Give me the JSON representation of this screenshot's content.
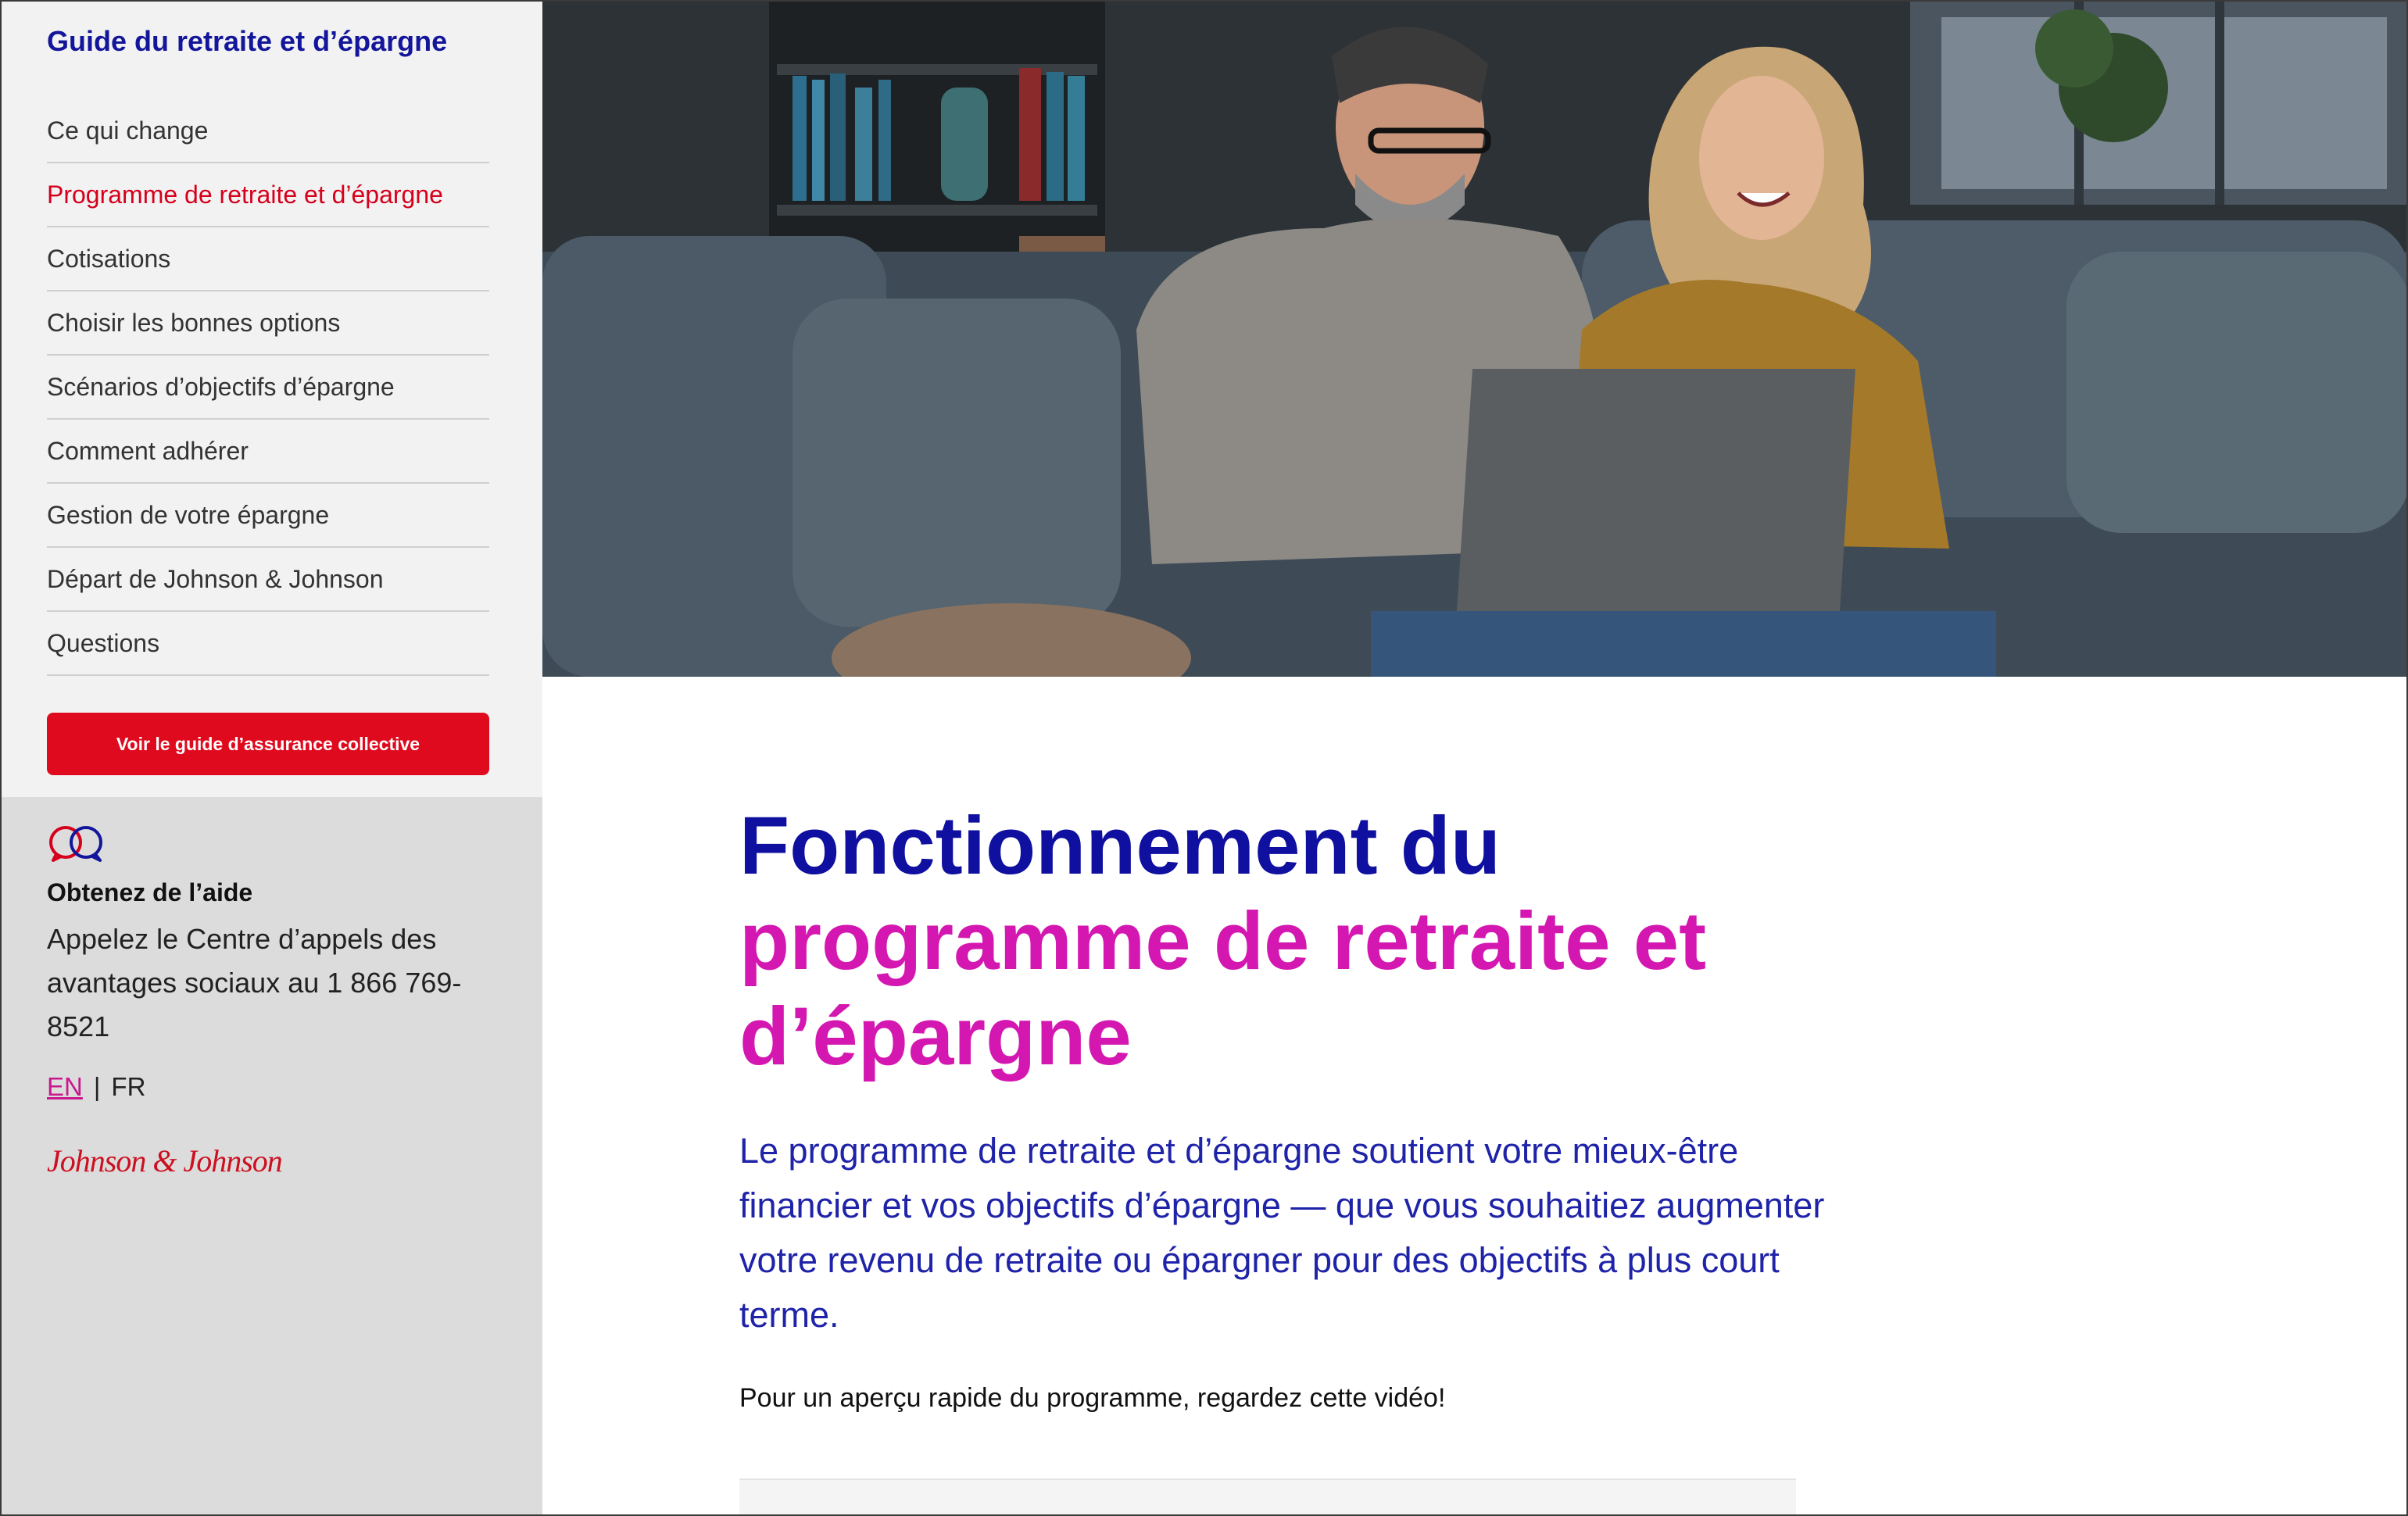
{
  "sidebar": {
    "title": "Guide du retraite et d’épargne",
    "items": [
      {
        "label": "Ce qui change",
        "active": false
      },
      {
        "label": "Programme de retraite et d’épargne",
        "active": true
      },
      {
        "label": "Cotisations",
        "active": false
      },
      {
        "label": "Choisir les bonnes options",
        "active": false
      },
      {
        "label": "Scénarios d’objectifs d’épargne",
        "active": false
      },
      {
        "label": "Comment adhérer",
        "active": false
      },
      {
        "label": "Gestion de votre épargne",
        "active": false
      },
      {
        "label": "Départ de Johnson & Johnson",
        "active": false
      },
      {
        "label": "Questions",
        "active": false
      }
    ],
    "cta_label": "Voir le guide d’assurance collective",
    "help": {
      "icon": "chat-bubbles-icon",
      "title": "Obtenez de l’aide",
      "text": "Appelez le Centre d’appels des avantages sociaux au 1 866 769-8521"
    },
    "lang": {
      "en": "EN",
      "separator": "|",
      "fr": "FR"
    },
    "logo_text": "Johnson & Johnson"
  },
  "main": {
    "headline_line1": "Fonctionnement du",
    "headline_line2": "programme de retraite et d’épargne",
    "lead": "Le programme de retraite et d’épargne soutient votre mieux-être financier et vos objectifs d’épargne — que vous souhaitiez augmenter votre revenu de retraite ou épargner pour des objectifs à plus court terme.",
    "video_note": "Pour un aperçu rapide du programme, regardez cette vidéo!"
  },
  "colors": {
    "navy": "#13169a",
    "magenta": "#d417b0",
    "red": "#e00a1e",
    "active_nav": "#d6001c"
  }
}
